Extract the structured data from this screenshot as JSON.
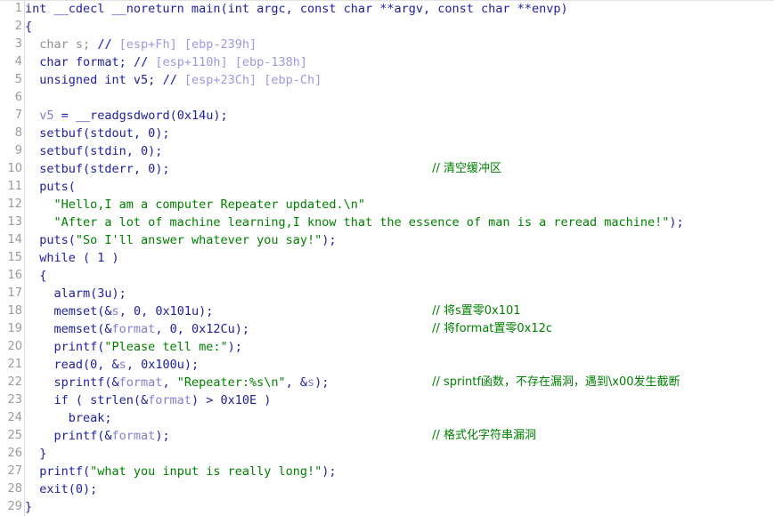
{
  "view": {
    "name": "pseudocode-decompiler-view",
    "background_color": "#ffffff",
    "gutter_color": "#9a9a9a",
    "colors": {
      "code_navy": "#2020a0",
      "string_green": "#008000",
      "comment_green": "#008000",
      "local_var_lavender": "#8080d0",
      "dim_grey": "#909090",
      "stack_offset": "#9a9ae0",
      "gutter_rule": "#dcdcdc"
    }
  },
  "lines": [
    {
      "n": "1",
      "tokens": [
        {
          "t": "int __cdecl __noreturn main(int argc, const char **argv, const char **envp)",
          "c": "fn"
        }
      ]
    },
    {
      "n": "2",
      "tokens": [
        {
          "t": "{",
          "c": "fn"
        }
      ]
    },
    {
      "n": "3",
      "tokens": [
        {
          "t": "  char s; ",
          "c": "dim"
        },
        {
          "t": "// ",
          "c": "slash"
        },
        {
          "t": "[esp+Fh] [ebp-239h]",
          "c": "stkoff"
        }
      ]
    },
    {
      "n": "4",
      "tokens": [
        {
          "t": "  char format; ",
          "c": "fn"
        },
        {
          "t": "// ",
          "c": "slash"
        },
        {
          "t": "[esp+110h] [ebp-138h]",
          "c": "stkoff"
        }
      ]
    },
    {
      "n": "5",
      "tokens": [
        {
          "t": "  unsigned int v5; ",
          "c": "fn"
        },
        {
          "t": "// ",
          "c": "slash"
        },
        {
          "t": "[esp+23Ch] [ebp-Ch]",
          "c": "stkoff"
        }
      ]
    },
    {
      "n": "6",
      "tokens": []
    },
    {
      "n": "7",
      "tokens": [
        {
          "t": "  ",
          "c": "fn"
        },
        {
          "t": "v5",
          "c": "lvar"
        },
        {
          "t": " = __readgsdword(0x14u);",
          "c": "fn"
        }
      ]
    },
    {
      "n": "8",
      "tokens": [
        {
          "t": "  setbuf(stdout, 0);",
          "c": "fn"
        }
      ]
    },
    {
      "n": "9",
      "tokens": [
        {
          "t": "  setbuf(stdin, 0);",
          "c": "fn"
        }
      ]
    },
    {
      "n": "10",
      "tokens": [
        {
          "t": "  setbuf(stderr, 0);",
          "c": "fn"
        }
      ],
      "comment": {
        "t": "// 清空缓冲区",
        "col": 57
      }
    },
    {
      "n": "11",
      "tokens": [
        {
          "t": "  puts(",
          "c": "fn"
        }
      ]
    },
    {
      "n": "12",
      "tokens": [
        {
          "t": "    ",
          "c": "fn"
        },
        {
          "t": "\"Hello,I am a computer Repeater updated.\\n\"",
          "c": "str"
        }
      ]
    },
    {
      "n": "13",
      "tokens": [
        {
          "t": "    ",
          "c": "fn"
        },
        {
          "t": "\"After a lot of machine learning,I know that the essence of man is a reread machine!\"",
          "c": "str"
        },
        {
          "t": ");",
          "c": "fn"
        }
      ]
    },
    {
      "n": "14",
      "tokens": [
        {
          "t": "  puts(",
          "c": "fn"
        },
        {
          "t": "\"So I'll answer whatever you say!\"",
          "c": "str"
        },
        {
          "t": ");",
          "c": "fn"
        }
      ]
    },
    {
      "n": "15",
      "tokens": [
        {
          "t": "  while ( 1 )",
          "c": "fn"
        }
      ]
    },
    {
      "n": "16",
      "tokens": [
        {
          "t": "  {",
          "c": "fn"
        }
      ]
    },
    {
      "n": "17",
      "tokens": [
        {
          "t": "    alarm(3u);",
          "c": "fn"
        }
      ]
    },
    {
      "n": "18",
      "tokens": [
        {
          "t": "    memset(&",
          "c": "fn"
        },
        {
          "t": "s",
          "c": "lvar"
        },
        {
          "t": ", 0, 0x101u);",
          "c": "fn"
        }
      ],
      "comment": {
        "t": "// 将s置零0x101",
        "col": 57
      }
    },
    {
      "n": "19",
      "tokens": [
        {
          "t": "    memset(&",
          "c": "fn"
        },
        {
          "t": "format",
          "c": "lvar"
        },
        {
          "t": ", 0, 0x12Cu);",
          "c": "fn"
        }
      ],
      "comment": {
        "t": "// 将format置零0x12c",
        "col": 57
      }
    },
    {
      "n": "20",
      "tokens": [
        {
          "t": "    printf(",
          "c": "fn"
        },
        {
          "t": "\"Please tell me:\"",
          "c": "str"
        },
        {
          "t": ");",
          "c": "fn"
        }
      ]
    },
    {
      "n": "21",
      "tokens": [
        {
          "t": "    read(0, &",
          "c": "fn"
        },
        {
          "t": "s",
          "c": "lvar"
        },
        {
          "t": ", 0x100u);",
          "c": "fn"
        }
      ]
    },
    {
      "n": "22",
      "tokens": [
        {
          "t": "    sprintf(&",
          "c": "fn"
        },
        {
          "t": "format",
          "c": "lvar"
        },
        {
          "t": ", ",
          "c": "fn"
        },
        {
          "t": "\"Repeater:%s\\n\"",
          "c": "str"
        },
        {
          "t": ", &",
          "c": "fn"
        },
        {
          "t": "s",
          "c": "lvar"
        },
        {
          "t": ");",
          "c": "fn"
        }
      ],
      "comment": {
        "t": "// sprintf函数，不存在漏洞，遇到\\x00发生截断",
        "col": 57
      }
    },
    {
      "n": "23",
      "tokens": [
        {
          "t": "    if ( strlen(&",
          "c": "fn"
        },
        {
          "t": "format",
          "c": "lvar"
        },
        {
          "t": ") > 0x10E )",
          "c": "fn"
        }
      ]
    },
    {
      "n": "24",
      "tokens": [
        {
          "t": "      break;",
          "c": "fn"
        }
      ]
    },
    {
      "n": "25",
      "tokens": [
        {
          "t": "    printf(&",
          "c": "fn"
        },
        {
          "t": "format",
          "c": "lvar"
        },
        {
          "t": ");",
          "c": "fn"
        }
      ],
      "comment": {
        "t": "// 格式化字符串漏洞",
        "col": 57
      }
    },
    {
      "n": "26",
      "tokens": [
        {
          "t": "  }",
          "c": "fn"
        }
      ]
    },
    {
      "n": "27",
      "tokens": [
        {
          "t": "  printf(",
          "c": "fn"
        },
        {
          "t": "\"what you input is really long!\"",
          "c": "str"
        },
        {
          "t": ");",
          "c": "fn"
        }
      ]
    },
    {
      "n": "28",
      "tokens": [
        {
          "t": "  exit(0);",
          "c": "fn"
        }
      ]
    },
    {
      "n": "29",
      "tokens": [
        {
          "t": "}",
          "c": "fn"
        }
      ]
    }
  ]
}
